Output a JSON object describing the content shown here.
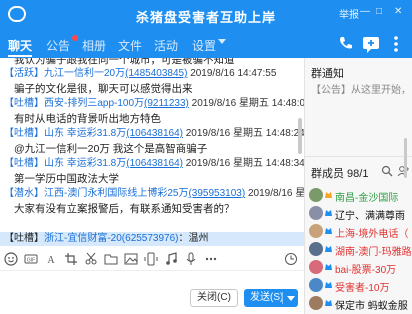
{
  "window": {
    "title": "杀猪盘受害者互助上岸",
    "controls": [
      "举报",
      "—",
      "□",
      "✕"
    ]
  },
  "tabs": [
    {
      "label": "聊天",
      "active": true
    },
    {
      "label": "公告",
      "badge": true
    },
    {
      "label": "相册"
    },
    {
      "label": "文件"
    },
    {
      "label": "活动"
    },
    {
      "label": "设置",
      "dropdown": true
    }
  ],
  "messages": [
    {
      "kind": "body",
      "text": "我认为骗子跟我在同一个城市，可是被骗不知道"
    },
    {
      "kind": "head",
      "tag": "【活跃】",
      "name": "九江一信利一20万",
      "uid": "(1485403845)",
      "time": "2019/8/16 14:47:55"
    },
    {
      "kind": "body",
      "text": "骗子的文化是很，聊天可以感觉得出来"
    },
    {
      "kind": "head",
      "tag": "【吐槽】",
      "name": "西安-排列三app-100万",
      "uid": "(9211233)",
      "time": "2019/8/16 星期五 14:48:09"
    },
    {
      "kind": "body",
      "text": "有时从电话的背景听出地方特色"
    },
    {
      "kind": "head",
      "tag": "【吐槽】",
      "name": "山东 幸运彩31.8万",
      "uid": "(106438164)",
      "time": "2019/8/16 星期五 14:48:24"
    },
    {
      "kind": "body",
      "text": "@九江一信利一20万  我这个是高智商骗子"
    },
    {
      "kind": "head",
      "tag": "【吐槽】",
      "name": "山东 幸运彩31.8万",
      "uid": "(106438164)",
      "time": "2019/8/16 星期五 14:48:34"
    },
    {
      "kind": "body",
      "text": "第一学历中国政法大学"
    },
    {
      "kind": "head",
      "tag": "【潜水】",
      "name": "江西-澳门永利国际线上博彩25万",
      "uid": "(395953103)",
      "time": "2019/8/16 星期五 14:48:38"
    },
    {
      "kind": "body",
      "text": "大家有没有立案报警后，有联系通知受害者的？"
    }
  ],
  "notice": {
    "tag": "【吐槽】",
    "name": "浙江-宜信财富-20",
    "uid": "(625573976)",
    "text": "：温州"
  },
  "buttons": {
    "close": "关闭(C)",
    "send": "发送(S)"
  },
  "sidebar": {
    "notice_title": "群通知",
    "notice_text": "【公告】从这里开始，",
    "members_title": "群成员 98/1",
    "members": [
      {
        "name": "南昌-金沙国际",
        "color": "#2f9e44",
        "role": "owner"
      },
      {
        "name": "辽宁、满满尊雨",
        "color": "#111111",
        "role": "admin"
      },
      {
        "name": "上海-境外电话（",
        "color": "#e03131",
        "role": "admin"
      },
      {
        "name": "湖南-澳门-玛雅路",
        "color": "#e03131",
        "role": "admin"
      },
      {
        "name": "bai-股票-30万",
        "color": "#e03131",
        "role": "admin"
      },
      {
        "name": "受害者-10万",
        "color": "#e03131",
        "role": "admin"
      },
      {
        "name": "保定市 蚂蚁金服",
        "color": "#111111",
        "role": "admin"
      }
    ]
  }
}
